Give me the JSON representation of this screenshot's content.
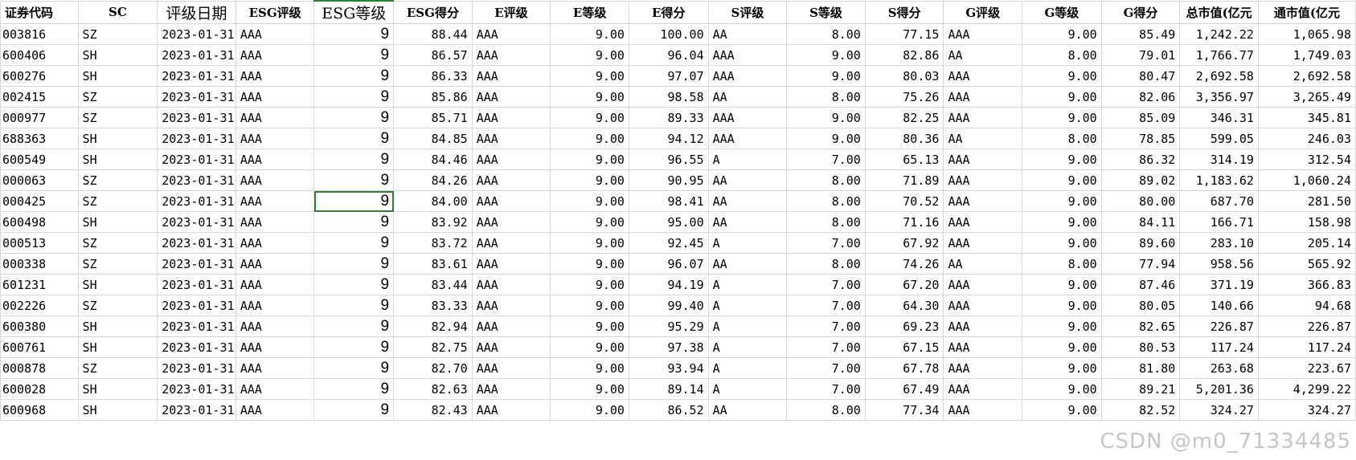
{
  "headers": [
    "证券代码",
    "SC",
    "评级日期",
    "ESG评级",
    "ESG等级",
    "ESG得分",
    "E评级",
    "E等级",
    "E得分",
    "S评级",
    "S等级",
    "S得分",
    "G评级",
    "G等级",
    "G得分",
    "总市值(亿元",
    "通市值(亿元"
  ],
  "rows": [
    [
      "003816",
      "SZ",
      "2023-01-31",
      "AAA",
      "9",
      "88.44",
      "AAA",
      "9.00",
      "100.00",
      "AA",
      "8.00",
      "77.15",
      "AAA",
      "9.00",
      "85.49",
      "1,242.22",
      "1,065.98"
    ],
    [
      "600406",
      "SH",
      "2023-01-31",
      "AAA",
      "9",
      "86.57",
      "AAA",
      "9.00",
      "96.04",
      "AAA",
      "9.00",
      "82.86",
      "AA",
      "8.00",
      "79.01",
      "1,766.77",
      "1,749.03"
    ],
    [
      "600276",
      "SH",
      "2023-01-31",
      "AAA",
      "9",
      "86.33",
      "AAA",
      "9.00",
      "97.07",
      "AAA",
      "9.00",
      "80.03",
      "AAA",
      "9.00",
      "80.47",
      "2,692.58",
      "2,692.58"
    ],
    [
      "002415",
      "SZ",
      "2023-01-31",
      "AAA",
      "9",
      "85.86",
      "AAA",
      "9.00",
      "98.58",
      "AA",
      "8.00",
      "75.26",
      "AAA",
      "9.00",
      "82.06",
      "3,356.97",
      "3,265.49"
    ],
    [
      "000977",
      "SZ",
      "2023-01-31",
      "AAA",
      "9",
      "85.71",
      "AAA",
      "9.00",
      "89.33",
      "AAA",
      "9.00",
      "82.25",
      "AAA",
      "9.00",
      "85.09",
      "346.31",
      "345.81"
    ],
    [
      "688363",
      "SH",
      "2023-01-31",
      "AAA",
      "9",
      "84.85",
      "AAA",
      "9.00",
      "94.12",
      "AAA",
      "9.00",
      "80.36",
      "AA",
      "8.00",
      "78.85",
      "599.05",
      "246.03"
    ],
    [
      "600549",
      "SH",
      "2023-01-31",
      "AAA",
      "9",
      "84.46",
      "AAA",
      "9.00",
      "96.55",
      "A",
      "7.00",
      "65.13",
      "AAA",
      "9.00",
      "86.32",
      "314.19",
      "312.54"
    ],
    [
      "000063",
      "SZ",
      "2023-01-31",
      "AAA",
      "9",
      "84.26",
      "AAA",
      "9.00",
      "90.95",
      "AA",
      "8.00",
      "71.89",
      "AAA",
      "9.00",
      "89.02",
      "1,183.62",
      "1,060.24"
    ],
    [
      "000425",
      "SZ",
      "2023-01-31",
      "AAA",
      "9",
      "84.00",
      "AAA",
      "9.00",
      "98.41",
      "AA",
      "8.00",
      "70.52",
      "AAA",
      "9.00",
      "80.00",
      "687.70",
      "281.50"
    ],
    [
      "600498",
      "SH",
      "2023-01-31",
      "AAA",
      "9",
      "83.92",
      "AAA",
      "9.00",
      "95.00",
      "AA",
      "8.00",
      "71.16",
      "AAA",
      "9.00",
      "84.11",
      "166.71",
      "158.98"
    ],
    [
      "000513",
      "SZ",
      "2023-01-31",
      "AAA",
      "9",
      "83.72",
      "AAA",
      "9.00",
      "92.45",
      "A",
      "7.00",
      "67.92",
      "AAA",
      "9.00",
      "89.60",
      "283.10",
      "205.14"
    ],
    [
      "000338",
      "SZ",
      "2023-01-31",
      "AAA",
      "9",
      "83.61",
      "AAA",
      "9.00",
      "96.07",
      "AA",
      "8.00",
      "74.26",
      "AA",
      "8.00",
      "77.94",
      "958.56",
      "565.92"
    ],
    [
      "601231",
      "SH",
      "2023-01-31",
      "AAA",
      "9",
      "83.44",
      "AAA",
      "9.00",
      "94.19",
      "A",
      "7.00",
      "67.20",
      "AAA",
      "9.00",
      "87.46",
      "371.19",
      "366.83"
    ],
    [
      "002226",
      "SZ",
      "2023-01-31",
      "AAA",
      "9",
      "83.33",
      "AAA",
      "9.00",
      "99.40",
      "A",
      "7.00",
      "64.30",
      "AAA",
      "9.00",
      "80.05",
      "140.66",
      "94.68"
    ],
    [
      "600380",
      "SH",
      "2023-01-31",
      "AAA",
      "9",
      "82.94",
      "AAA",
      "9.00",
      "95.29",
      "A",
      "7.00",
      "69.23",
      "AAA",
      "9.00",
      "82.65",
      "226.87",
      "226.87"
    ],
    [
      "600761",
      "SH",
      "2023-01-31",
      "AAA",
      "9",
      "82.75",
      "AAA",
      "9.00",
      "97.38",
      "A",
      "7.00",
      "67.15",
      "AAA",
      "9.00",
      "80.53",
      "117.24",
      "117.24"
    ],
    [
      "000878",
      "SZ",
      "2023-01-31",
      "AAA",
      "9",
      "82.70",
      "AAA",
      "9.00",
      "93.94",
      "A",
      "7.00",
      "67.78",
      "AAA",
      "9.00",
      "81.80",
      "263.68",
      "223.67"
    ],
    [
      "600028",
      "SH",
      "2023-01-31",
      "AAA",
      "9",
      "82.63",
      "AAA",
      "9.00",
      "89.14",
      "A",
      "7.00",
      "67.49",
      "AAA",
      "9.00",
      "89.21",
      "5,201.36",
      "4,299.22"
    ],
    [
      "600968",
      "SH",
      "2023-01-31",
      "AAA",
      "9",
      "82.43",
      "AAA",
      "9.00",
      "86.52",
      "AA",
      "8.00",
      "77.34",
      "AAA",
      "9.00",
      "82.52",
      "324.27",
      "324.27"
    ]
  ],
  "watermark": "CSDN @m0_71334485",
  "colors": {
    "selection": "#2e7d32",
    "gridline": "#d9d9d9"
  }
}
